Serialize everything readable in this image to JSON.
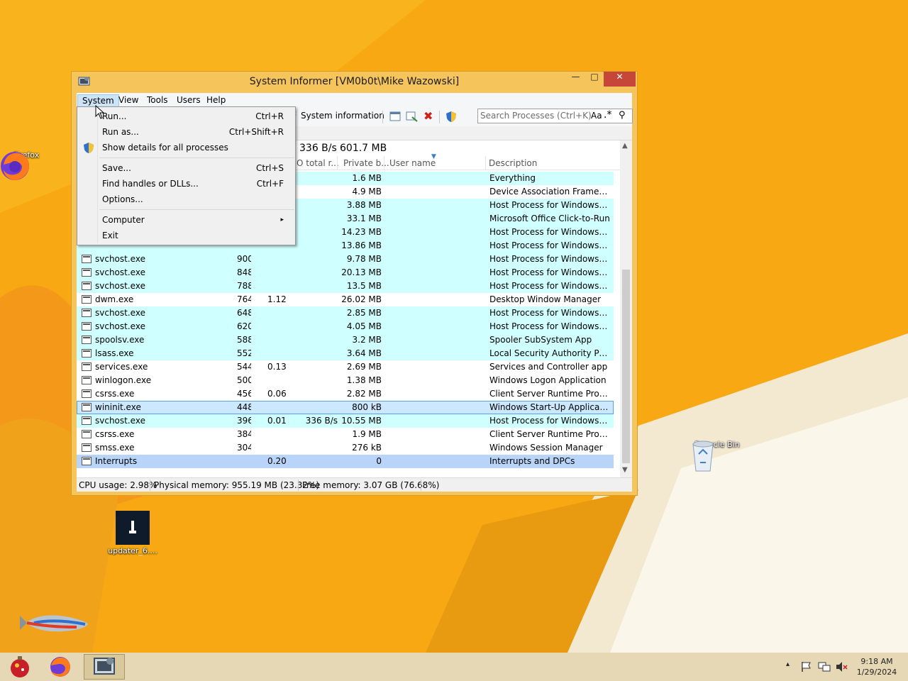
{
  "desktop": {
    "icons": [
      {
        "id": "firefox",
        "label": "Firefox"
      },
      {
        "id": "recycle",
        "label": "Recycle Bin"
      },
      {
        "id": "updater",
        "label": "updater_6...."
      }
    ]
  },
  "window": {
    "title": "System Informer [VM0b0t\\Mike Wazowski]",
    "controls": {
      "minimize": "—",
      "maximize": "□",
      "close": "✕"
    },
    "menu": [
      "System",
      "View",
      "Tools",
      "Users",
      "Help"
    ],
    "toolbar": {
      "system_information": "System information"
    },
    "search": {
      "placeholder": "Search Processes (Ctrl+K)",
      "case": "Aa",
      "regex": ".*"
    },
    "graphs": {
      "io": "336 B/s",
      "memory": "601.7 MB"
    },
    "columns": {
      "io_total": "O total r...",
      "private_bytes": "Private b...",
      "user_name": "User name",
      "description": "Description"
    },
    "processes": [
      {
        "name": "",
        "pid": "",
        "cpu": "",
        "io": "",
        "private": "1.6 MB",
        "desc": "Everything",
        "style": "cyan"
      },
      {
        "name": "",
        "pid": "",
        "cpu": "",
        "io": "",
        "private": "4.9 MB",
        "desc": "Device Association Framewor...",
        "style": "white"
      },
      {
        "name": "",
        "pid": "",
        "cpu": "",
        "io": "",
        "private": "3.88 MB",
        "desc": "Host Process for Windows Ser...",
        "style": "cyan"
      },
      {
        "name": "",
        "pid": "",
        "cpu": "",
        "io": "",
        "private": "33.1 MB",
        "desc": "Microsoft Office Click-to-Run",
        "style": "cyan"
      },
      {
        "name": "",
        "pid": "",
        "cpu": "",
        "io": "",
        "private": "14.23 MB",
        "desc": "Host Process for Windows Ser...",
        "style": "cyan"
      },
      {
        "name": "",
        "pid": "",
        "cpu": "",
        "io": "",
        "private": "13.86 MB",
        "desc": "Host Process for Windows Ser...",
        "style": "cyan"
      },
      {
        "name": "svchost.exe",
        "pid": "900",
        "cpu": "",
        "io": "",
        "private": "9.78 MB",
        "desc": "Host Process for Windows Ser...",
        "style": "cyan"
      },
      {
        "name": "svchost.exe",
        "pid": "848",
        "cpu": "",
        "io": "",
        "private": "20.13 MB",
        "desc": "Host Process for Windows Ser...",
        "style": "cyan"
      },
      {
        "name": "svchost.exe",
        "pid": "788",
        "cpu": "",
        "io": "",
        "private": "13.5 MB",
        "desc": "Host Process for Windows Ser...",
        "style": "cyan"
      },
      {
        "name": "dwm.exe",
        "pid": "764",
        "cpu": "1.12",
        "io": "",
        "private": "26.02 MB",
        "desc": "Desktop Window Manager",
        "style": "white"
      },
      {
        "name": "svchost.exe",
        "pid": "648",
        "cpu": "",
        "io": "",
        "private": "2.85 MB",
        "desc": "Host Process for Windows Ser...",
        "style": "cyan"
      },
      {
        "name": "svchost.exe",
        "pid": "620",
        "cpu": "",
        "io": "",
        "private": "4.05 MB",
        "desc": "Host Process for Windows Ser...",
        "style": "cyan"
      },
      {
        "name": "spoolsv.exe",
        "pid": "588",
        "cpu": "",
        "io": "",
        "private": "3.2 MB",
        "desc": "Spooler SubSystem App",
        "style": "cyan"
      },
      {
        "name": "lsass.exe",
        "pid": "552",
        "cpu": "",
        "io": "",
        "private": "3.64 MB",
        "desc": "Local Security Authority Proce...",
        "style": "cyan"
      },
      {
        "name": "services.exe",
        "pid": "544",
        "cpu": "0.13",
        "io": "",
        "private": "2.69 MB",
        "desc": "Services and Controller app",
        "style": "white"
      },
      {
        "name": "winlogon.exe",
        "pid": "500",
        "cpu": "",
        "io": "",
        "private": "1.38 MB",
        "desc": "Windows Logon Application",
        "style": "white"
      },
      {
        "name": "csrss.exe",
        "pid": "456",
        "cpu": "0.06",
        "io": "",
        "private": "2.82 MB",
        "desc": "Client Server Runtime Process",
        "style": "white"
      },
      {
        "name": "wininit.exe",
        "pid": "448",
        "cpu": "",
        "io": "",
        "private": "800 kB",
        "desc": "Windows Start-Up Application",
        "style": "sel"
      },
      {
        "name": "svchost.exe",
        "pid": "396",
        "cpu": "0.01",
        "io": "336 B/s",
        "private": "10.55 MB",
        "desc": "Host Process for Windows Ser...",
        "style": "cyan"
      },
      {
        "name": "csrss.exe",
        "pid": "384",
        "cpu": "",
        "io": "",
        "private": "1.9 MB",
        "desc": "Client Server Runtime Process",
        "style": "white"
      },
      {
        "name": "smss.exe",
        "pid": "304",
        "cpu": "",
        "io": "",
        "private": "276 kB",
        "desc": "Windows Session Manager",
        "style": "white"
      },
      {
        "name": "Interrupts",
        "pid": "",
        "cpu": "0.20",
        "io": "",
        "private": "0",
        "desc": "Interrupts and DPCs",
        "style": "blue"
      }
    ],
    "status": {
      "cpu": "CPU usage: 2.98%",
      "physical": "Physical memory: 955.19 MB (23.32%)",
      "free": "Free memory: 3.07 GB (76.68%)"
    }
  },
  "system_menu": {
    "items": [
      {
        "label": "Run...",
        "shortcut": "Ctrl+R"
      },
      {
        "label": "Run as...",
        "shortcut": "Ctrl+Shift+R"
      },
      {
        "label": "Show details for all processes",
        "shortcut": ""
      },
      {
        "label": "Save...",
        "shortcut": "Ctrl+S"
      },
      {
        "label": "Find handles or DLLs...",
        "shortcut": "Ctrl+F"
      },
      {
        "label": "Options...",
        "shortcut": ""
      },
      {
        "label": "Computer",
        "shortcut": "▸"
      },
      {
        "label": "Exit",
        "shortcut": ""
      }
    ]
  },
  "taskbar": {
    "tray_arrow": "▴",
    "time": "9:18 AM",
    "date": "1/29/2024"
  },
  "colors": {
    "desktop_bg": "#f6a712",
    "row_cyan": "#d0ffff",
    "row_selected": "#cce8ff",
    "row_interrupts": "#b8d4f8",
    "close_button": "#c7463a"
  }
}
